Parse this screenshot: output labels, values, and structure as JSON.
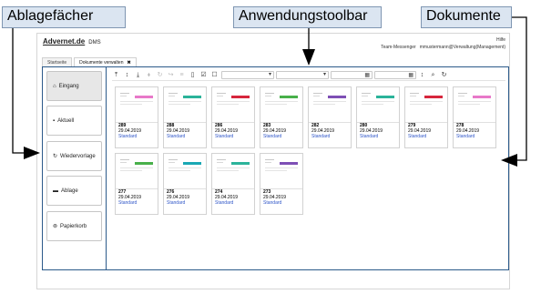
{
  "callouts": {
    "folders": "Ablagefächer",
    "toolbar": "Anwendungstoolbar",
    "documents": "Dokumente"
  },
  "header": {
    "logo": "Advernet.de",
    "product": "DMS",
    "help": "Hilfe",
    "messenger": "Team-Messenger",
    "user": "mmustermann@Verwaltung(Management)"
  },
  "tabs": [
    {
      "label": "Startseite",
      "close": ""
    },
    {
      "label": "Dokumente verwalten",
      "close": "✖"
    }
  ],
  "folders": [
    {
      "label": "Eingang",
      "icon": "inbox-icon",
      "glyph": "⌂"
    },
    {
      "label": "Aktuell",
      "icon": "briefcase-icon",
      "glyph": "▪"
    },
    {
      "label": "Wiedervorlage",
      "icon": "refresh-icon",
      "glyph": "↻"
    },
    {
      "label": "Ablage",
      "icon": "archive-icon",
      "glyph": "▬"
    },
    {
      "label": "Papierkorb",
      "icon": "trash-icon",
      "glyph": "⊚"
    }
  ],
  "toolbar": {
    "icons": [
      {
        "name": "upload-icon",
        "glyph": "⤒"
      },
      {
        "name": "sort-icon",
        "glyph": "↕"
      },
      {
        "name": "download-icon",
        "glyph": "⤓"
      },
      {
        "name": "tag-icon",
        "glyph": "⬧"
      },
      {
        "name": "rotate-icon",
        "glyph": "↻"
      },
      {
        "name": "forward-icon",
        "glyph": "↪"
      },
      {
        "name": "list-icon",
        "glyph": "≡"
      },
      {
        "name": "file-icon",
        "glyph": "▯"
      },
      {
        "name": "checkbox-checked-icon",
        "glyph": "☑"
      },
      {
        "name": "checkbox-icon",
        "glyph": "☐"
      }
    ],
    "filters": [
      {
        "name": "filter-dropdown-1",
        "value": "",
        "glyph": "▾"
      },
      {
        "name": "filter-dropdown-2",
        "value": "",
        "glyph": "▾"
      },
      {
        "name": "date-from",
        "value": "",
        "glyph": "▦"
      },
      {
        "name": "date-to",
        "value": "",
        "glyph": "▦"
      }
    ],
    "trailing": [
      {
        "name": "sort-order-icon",
        "glyph": "↕"
      },
      {
        "name": "search-icon",
        "glyph": "⌕"
      },
      {
        "name": "reload-icon",
        "glyph": "↻"
      }
    ]
  },
  "documents": [
    {
      "number": "289",
      "date": "29.04.2019",
      "type": "Standard",
      "color": "#e879c9"
    },
    {
      "number": "288",
      "date": "29.04.2019",
      "type": "Standard",
      "color": "#2bb39a"
    },
    {
      "number": "286",
      "date": "29.04.2019",
      "type": "Standard",
      "color": "#d7263d"
    },
    {
      "number": "283",
      "date": "29.04.2019",
      "type": "Standard",
      "color": "#48b04a"
    },
    {
      "number": "282",
      "date": "29.04.2019",
      "type": "Standard",
      "color": "#7e4fb5"
    },
    {
      "number": "280",
      "date": "29.04.2019",
      "type": "Standard",
      "color": "#2bb39a"
    },
    {
      "number": "279",
      "date": "29.04.2019",
      "type": "Standard",
      "color": "#d7263d"
    },
    {
      "number": "278",
      "date": "29.04.2019",
      "type": "Standard",
      "color": "#e879c9"
    },
    {
      "number": "277",
      "date": "29.04.2019",
      "type": "Standard",
      "color": "#48b04a"
    },
    {
      "number": "276",
      "date": "29.04.2019",
      "type": "Standard",
      "color": "#1aa8b4"
    },
    {
      "number": "274",
      "date": "29.04.2019",
      "type": "Standard",
      "color": "#2bb39a"
    },
    {
      "number": "273",
      "date": "29.04.2019",
      "type": "Standard",
      "color": "#7e4fb5"
    }
  ]
}
